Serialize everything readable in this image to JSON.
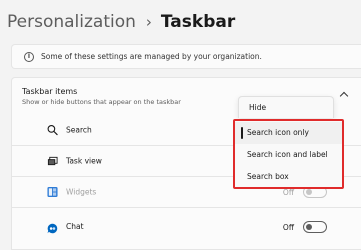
{
  "breadcrumb": {
    "parent": "Personalization",
    "separator": "›",
    "current": "Taskbar"
  },
  "banner": {
    "text": "Some of these settings are managed by your organization.",
    "icon": "info-icon"
  },
  "section": {
    "title": "Taskbar items",
    "subtitle": "Show or hide buttons that appear on the taskbar",
    "icon": "chevron-up-icon"
  },
  "rows": [
    {
      "label": "Search",
      "icon": "search-icon",
      "disabled": false
    },
    {
      "label": "Task view",
      "icon": "task-view-icon",
      "disabled": false
    },
    {
      "label": "Widgets",
      "icon": "widgets-icon",
      "disabled": true,
      "toggle_state": "Off"
    },
    {
      "label": "Chat",
      "icon": "chat-icon",
      "disabled": false,
      "toggle_state": "Off"
    }
  ],
  "dropdown": {
    "options": [
      "Hide",
      "Search icon only",
      "Search icon and label",
      "Search box"
    ],
    "selected": "Search icon only",
    "highlight_color": "#e02b2b"
  },
  "colors": {
    "accent_chat": "#0067c0",
    "widgets_blue": "#2f7cd6",
    "highlight": "#e02b2b"
  }
}
